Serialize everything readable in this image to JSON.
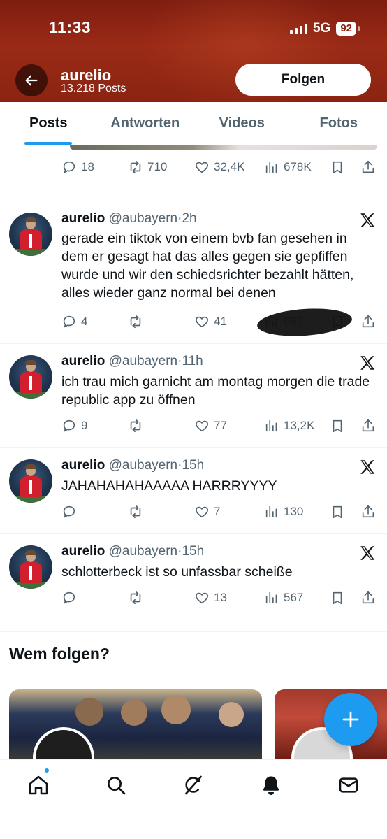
{
  "status_bar": {
    "time": "11:33",
    "network": "5G",
    "battery": "92"
  },
  "header": {
    "name": "aurelio",
    "posts_count": "13.218 Posts",
    "follow_label": "Folgen"
  },
  "tabs": [
    {
      "label": "Posts",
      "active": true
    },
    {
      "label": "Antworten",
      "active": false
    },
    {
      "label": "Videos",
      "active": false
    },
    {
      "label": "Fotos",
      "active": false
    }
  ],
  "first_post_actions": {
    "replies": "18",
    "reposts": "710",
    "likes": "32,4K",
    "views": "678K"
  },
  "posts": [
    {
      "name": "aurelio",
      "handle": "@aubayern",
      "time": "2h",
      "text": "gerade ein tiktok von einem bvb fan gesehen in dem er gesagt hat das alles gegen sie gepfiffen wurde und wir den schiedsrichter bezahlt hätten, alles wieder ganz normal bei denen",
      "replies": "4",
      "reposts": "",
      "likes": "41",
      "views": "987"
    },
    {
      "name": "aurelio",
      "handle": "@aubayern",
      "time": "11h",
      "text": "ich trau mich garnicht am montag morgen die trade republic app zu öffnen",
      "replies": "9",
      "reposts": "",
      "likes": "77",
      "views": "13,2K"
    },
    {
      "name": "aurelio",
      "handle": "@aubayern",
      "time": "15h",
      "text": "JAHAHAHAHAAAAA HARRRYYYY",
      "replies": "",
      "reposts": "",
      "likes": "7",
      "views": "130"
    },
    {
      "name": "aurelio",
      "handle": "@aubayern",
      "time": "15h",
      "text": "schlotterbeck ist so unfassbar scheiße",
      "replies": "",
      "reposts": "",
      "likes": "13",
      "views": "567"
    }
  ],
  "who_to_follow": {
    "title": "Wem folgen?"
  },
  "colors": {
    "accent": "#1d9bf0",
    "text": "#0f1419",
    "secondary": "#536471",
    "header_bg": "#8a2412"
  },
  "icons": {
    "back": "arrow-left-icon",
    "reply": "reply-icon",
    "repost": "repost-icon",
    "like": "heart-icon",
    "views": "views-icon",
    "bookmark": "bookmark-icon",
    "share": "share-icon",
    "x_logo": "x-logo-icon",
    "compose": "plus-icon",
    "nav": [
      "home-icon",
      "search-icon",
      "grok-icon",
      "bell-icon",
      "mail-icon"
    ]
  }
}
